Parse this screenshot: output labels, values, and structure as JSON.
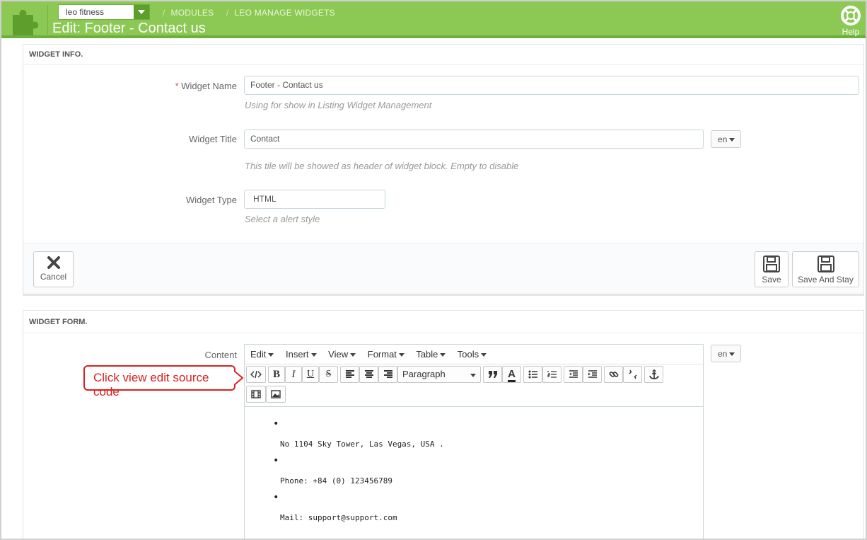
{
  "header": {
    "shop_select_value": "leo fitness",
    "breadcrumb": [
      "MODULES",
      "LEO MANAGE WIDGETS"
    ],
    "title": "Edit: Footer - Contact us",
    "help_label": "Help"
  },
  "widget_info": {
    "heading": "WIDGET INFO.",
    "name_label": "Widget Name",
    "name_required_mark": "*",
    "name_value": "Footer - Contact us",
    "name_help": "Using for show in Listing Widget Management",
    "title_label": "Widget Title",
    "title_value": "Contact",
    "title_lang": "en",
    "title_help": "This tile will be showed as header of widget block. Empty to disable",
    "type_label": "Widget Type",
    "type_value": "HTML",
    "type_help": "Select a alert style",
    "cancel_label": "Cancel",
    "save_label": "Save",
    "save_stay_label": "Save And Stay"
  },
  "widget_form": {
    "heading": "WIDGET FORM.",
    "content_label": "Content",
    "content_lang": "en",
    "menu": [
      "Edit",
      "Insert",
      "View",
      "Format",
      "Table",
      "Tools"
    ],
    "format_select": "Paragraph",
    "content_lines": [
      "No 1104 Sky Tower, Las Vegas, USA .",
      "Phone: +84 (0) 123456789",
      "Mail: support@support.com"
    ]
  },
  "callout": {
    "text": "Click view edit source code",
    "color": "#d9201f"
  },
  "colors": {
    "header_green": "#8bc954",
    "header_green_dark": "#6fae3b"
  }
}
